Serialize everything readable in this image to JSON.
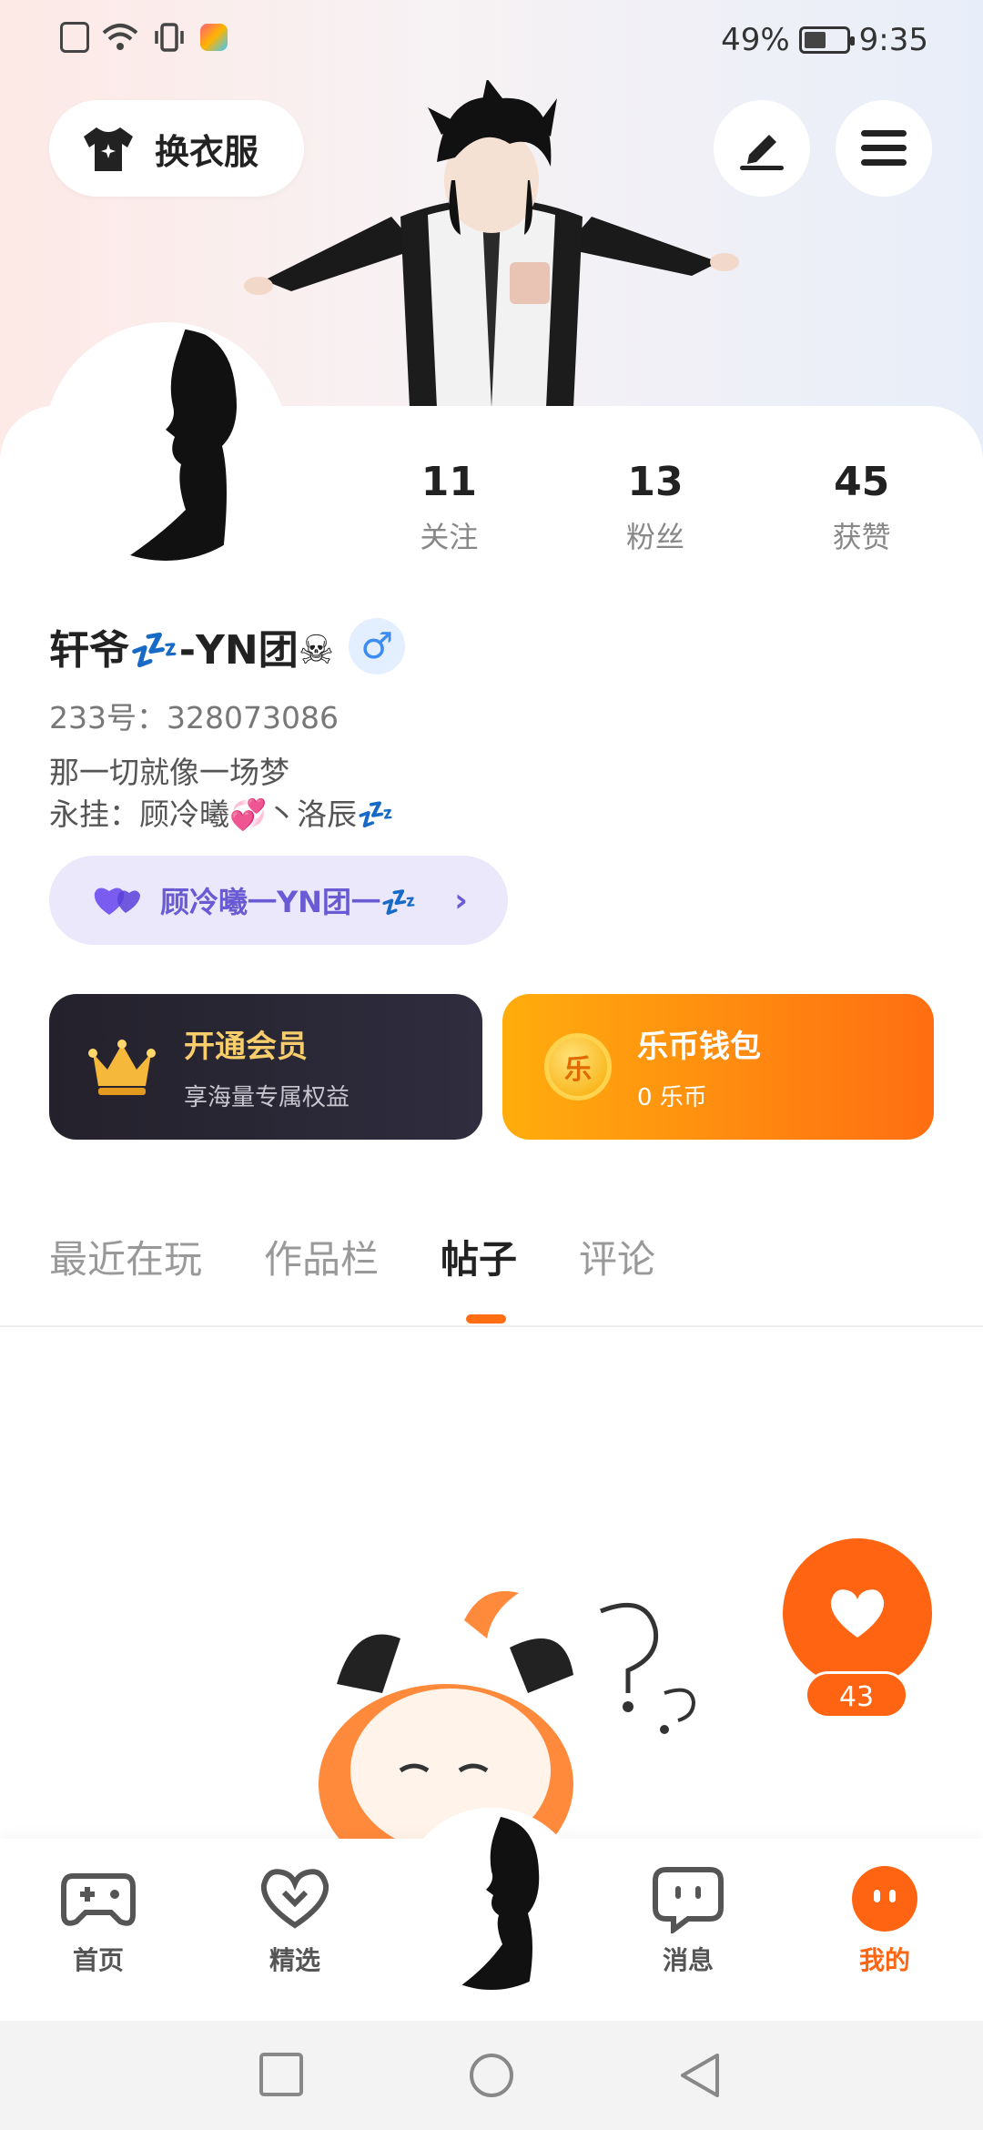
{
  "status_bar": {
    "battery_percent": "49%",
    "time": "9:35"
  },
  "header": {
    "outfit_label": "换衣服"
  },
  "profile": {
    "stats": [
      {
        "value": "11",
        "label": "关注"
      },
      {
        "value": "13",
        "label": "粉丝"
      },
      {
        "value": "45",
        "label": "获赞"
      }
    ],
    "name": "轩爷💤-YN团☠",
    "gender_symbol": "♂",
    "uid": "233号：328073086",
    "bio_line1": "那一切就像一场梦",
    "bio_line2": "永挂：顾冷曦💞丶洛辰💤",
    "group_label": "顾冷曦一YN团一💤"
  },
  "cards": {
    "vip_title": "开通会员",
    "vip_sub": "享海量专属权益",
    "wallet_title": "乐币钱包",
    "wallet_sub": "0 乐币",
    "coin_glyph": "乐"
  },
  "tabs": [
    "最近在玩",
    "作品栏",
    "帖子",
    "评论"
  ],
  "active_tab": "帖子",
  "like_count": "43",
  "bottom_nav": {
    "home": "首页",
    "featured": "精选",
    "messages": "消息",
    "mine": "我的"
  },
  "colors": {
    "accent": "#ff6412",
    "vip_gold": "#f8cd6b",
    "group_purple": "#6a5bd4"
  }
}
